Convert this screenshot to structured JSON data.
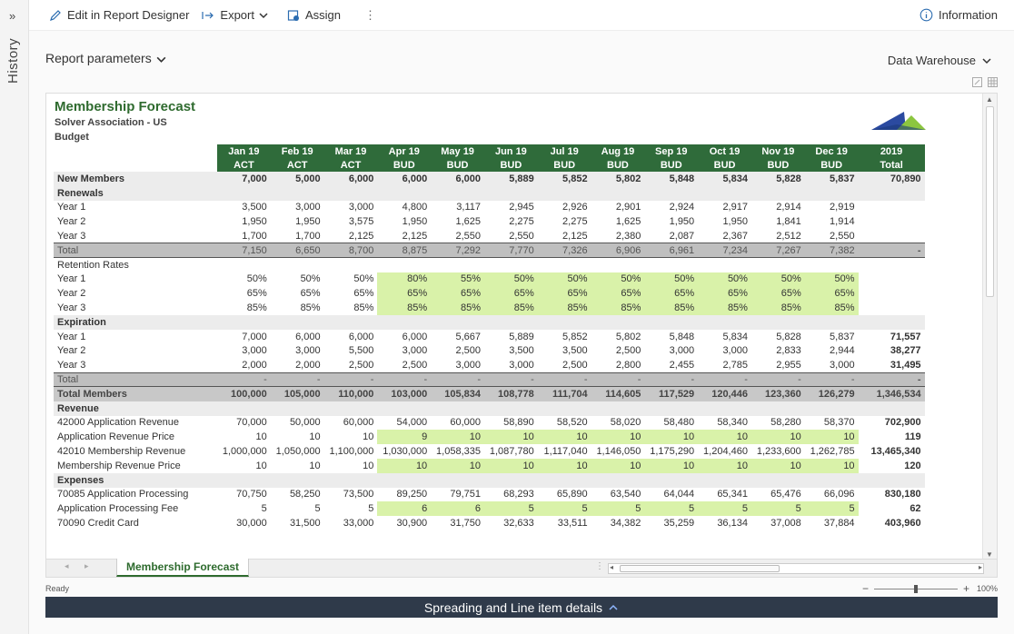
{
  "sidebar": {
    "expand_glyph": "»",
    "label": "History"
  },
  "toolbar": {
    "edit_label": "Edit in Report Designer",
    "export_label": "Export",
    "assign_label": "Assign",
    "more_glyph": "⋮",
    "info_label": "Information"
  },
  "params_label": "Report parameters",
  "datasource_label": "Data Warehouse",
  "report": {
    "title": "Membership Forecast",
    "org": "Solver Association - US",
    "scenario": "Budget",
    "months": [
      "Jan 19",
      "Feb 19",
      "Mar 19",
      "Apr 19",
      "May 19",
      "Jun 19",
      "Jul 19",
      "Aug 19",
      "Sep 19",
      "Oct 19",
      "Nov 19",
      "Dec 19",
      "2019"
    ],
    "types": [
      "ACT",
      "ACT",
      "ACT",
      "BUD",
      "BUD",
      "BUD",
      "BUD",
      "BUD",
      "BUD",
      "BUD",
      "BUD",
      "BUD",
      "Total"
    ],
    "rows": [
      {
        "label": "New Members",
        "style": "sec",
        "values": [
          "7,000",
          "5,000",
          "6,000",
          "6,000",
          "6,000",
          "5,889",
          "5,852",
          "5,802",
          "5,848",
          "5,834",
          "5,828",
          "5,837",
          "70,890"
        ]
      },
      {
        "label": "Renewals",
        "style": "sec",
        "values": [
          "",
          "",
          "",
          "",
          "",
          "",
          "",
          "",
          "",
          "",
          "",
          "",
          ""
        ]
      },
      {
        "label": "Year 1",
        "style": "ind",
        "values": [
          "3,500",
          "3,000",
          "3,000",
          "4,800",
          "3,117",
          "2,945",
          "2,926",
          "2,901",
          "2,924",
          "2,917",
          "2,914",
          "2,919",
          ""
        ]
      },
      {
        "label": "Year 2",
        "style": "ind",
        "values": [
          "1,950",
          "1,950",
          "3,575",
          "1,950",
          "1,625",
          "2,275",
          "2,275",
          "1,625",
          "1,950",
          "1,950",
          "1,841",
          "1,914",
          ""
        ]
      },
      {
        "label": "Year 3",
        "style": "ind",
        "values": [
          "1,700",
          "1,700",
          "2,125",
          "2,125",
          "2,550",
          "2,550",
          "2,125",
          "2,380",
          "2,087",
          "2,367",
          "2,512",
          "2,550",
          ""
        ]
      },
      {
        "label": "Total",
        "style": "tot",
        "values": [
          "7,150",
          "6,650",
          "8,700",
          "8,875",
          "7,292",
          "7,770",
          "7,326",
          "6,906",
          "6,961",
          "7,234",
          "7,267",
          "7,382",
          "-"
        ]
      },
      {
        "label": "Retention Rates",
        "style": "plain",
        "values": [
          "",
          "",
          "",
          "",
          "",
          "",
          "",
          "",
          "",
          "",
          "",
          "",
          ""
        ]
      },
      {
        "label": "Year 1",
        "style": "green",
        "values": [
          "50%",
          "50%",
          "50%",
          "80%",
          "55%",
          "50%",
          "50%",
          "50%",
          "50%",
          "50%",
          "50%",
          "50%",
          ""
        ]
      },
      {
        "label": "Year 2",
        "style": "green",
        "values": [
          "65%",
          "65%",
          "65%",
          "65%",
          "65%",
          "65%",
          "65%",
          "65%",
          "65%",
          "65%",
          "65%",
          "65%",
          ""
        ]
      },
      {
        "label": "Year 3",
        "style": "green",
        "values": [
          "85%",
          "85%",
          "85%",
          "85%",
          "85%",
          "85%",
          "85%",
          "85%",
          "85%",
          "85%",
          "85%",
          "85%",
          ""
        ]
      },
      {
        "label": "Expiration",
        "style": "sec",
        "values": [
          "",
          "",
          "",
          "",
          "",
          "",
          "",
          "",
          "",
          "",
          "",
          "",
          ""
        ]
      },
      {
        "label": "Year 1",
        "style": "ind",
        "values": [
          "7,000",
          "6,000",
          "6,000",
          "6,000",
          "5,667",
          "5,889",
          "5,852",
          "5,802",
          "5,848",
          "5,834",
          "5,828",
          "5,837",
          "71,557"
        ]
      },
      {
        "label": "Year 2",
        "style": "ind",
        "values": [
          "3,000",
          "3,000",
          "5,500",
          "3,000",
          "2,500",
          "3,500",
          "3,500",
          "2,500",
          "3,000",
          "3,000",
          "2,833",
          "2,944",
          "38,277"
        ]
      },
      {
        "label": "Year 3",
        "style": "ind",
        "values": [
          "2,000",
          "2,000",
          "2,500",
          "2,500",
          "3,000",
          "3,000",
          "2,500",
          "2,800",
          "2,455",
          "2,785",
          "2,955",
          "3,000",
          "31,495"
        ]
      },
      {
        "label": "Total",
        "style": "tot",
        "values": [
          "-",
          "-",
          "-",
          "-",
          "-",
          "-",
          "-",
          "-",
          "-",
          "-",
          "-",
          "-",
          "-"
        ]
      },
      {
        "label": "Total Members",
        "style": "totbold",
        "values": [
          "100,000",
          "105,000",
          "110,000",
          "103,000",
          "105,834",
          "108,778",
          "111,704",
          "114,605",
          "117,529",
          "120,446",
          "123,360",
          "126,279",
          "1,346,534"
        ]
      },
      {
        "label": "Revenue",
        "style": "sec",
        "values": [
          "",
          "",
          "",
          "",
          "",
          "",
          "",
          "",
          "",
          "",
          "",
          "",
          ""
        ]
      },
      {
        "label": "42000 Application Revenue",
        "style": "ind",
        "values": [
          "70,000",
          "50,000",
          "60,000",
          "54,000",
          "60,000",
          "58,890",
          "58,520",
          "58,020",
          "58,480",
          "58,340",
          "58,280",
          "58,370",
          "702,900"
        ]
      },
      {
        "label": "Application Revenue Price",
        "style": "green",
        "values": [
          "10",
          "10",
          "10",
          "9",
          "10",
          "10",
          "10",
          "10",
          "10",
          "10",
          "10",
          "10",
          "119"
        ]
      },
      {
        "label": "42010 Membership Revenue",
        "style": "ind",
        "values": [
          "1,000,000",
          "1,050,000",
          "1,100,000",
          "1,030,000",
          "1,058,335",
          "1,087,780",
          "1,117,040",
          "1,146,050",
          "1,175,290",
          "1,204,460",
          "1,233,600",
          "1,262,785",
          "13,465,340"
        ]
      },
      {
        "label": "Membership Revenue Price",
        "style": "green",
        "values": [
          "10",
          "10",
          "10",
          "10",
          "10",
          "10",
          "10",
          "10",
          "10",
          "10",
          "10",
          "10",
          "120"
        ]
      },
      {
        "label": "Expenses",
        "style": "sec",
        "values": [
          "",
          "",
          "",
          "",
          "",
          "",
          "",
          "",
          "",
          "",
          "",
          "",
          ""
        ]
      },
      {
        "label": "70085 Application Processing",
        "style": "ind",
        "values": [
          "70,750",
          "58,250",
          "73,500",
          "89,250",
          "79,751",
          "68,293",
          "65,890",
          "63,540",
          "64,044",
          "65,341",
          "65,476",
          "66,096",
          "830,180"
        ]
      },
      {
        "label": "Application Processing Fee",
        "style": "green",
        "values": [
          "5",
          "5",
          "5",
          "6",
          "6",
          "5",
          "5",
          "5",
          "5",
          "5",
          "5",
          "5",
          "62"
        ]
      },
      {
        "label": "70090 Credit Card",
        "style": "ind",
        "values": [
          "30,000",
          "31,500",
          "33,000",
          "30,900",
          "31,750",
          "32,633",
          "33,511",
          "34,382",
          "35,259",
          "36,134",
          "37,008",
          "37,884",
          "403,960"
        ]
      }
    ]
  },
  "sheet_tab": "Membership Forecast",
  "status_text": "Ready",
  "zoom_text": "100%",
  "bottom_bar_label": "Spreading and Line item details",
  "colors": {
    "header_green": "#2f6b3a",
    "input_green": "#d9f2a9",
    "title_green": "#2f6b2f",
    "bottom_bar": "#2f3a4a"
  }
}
